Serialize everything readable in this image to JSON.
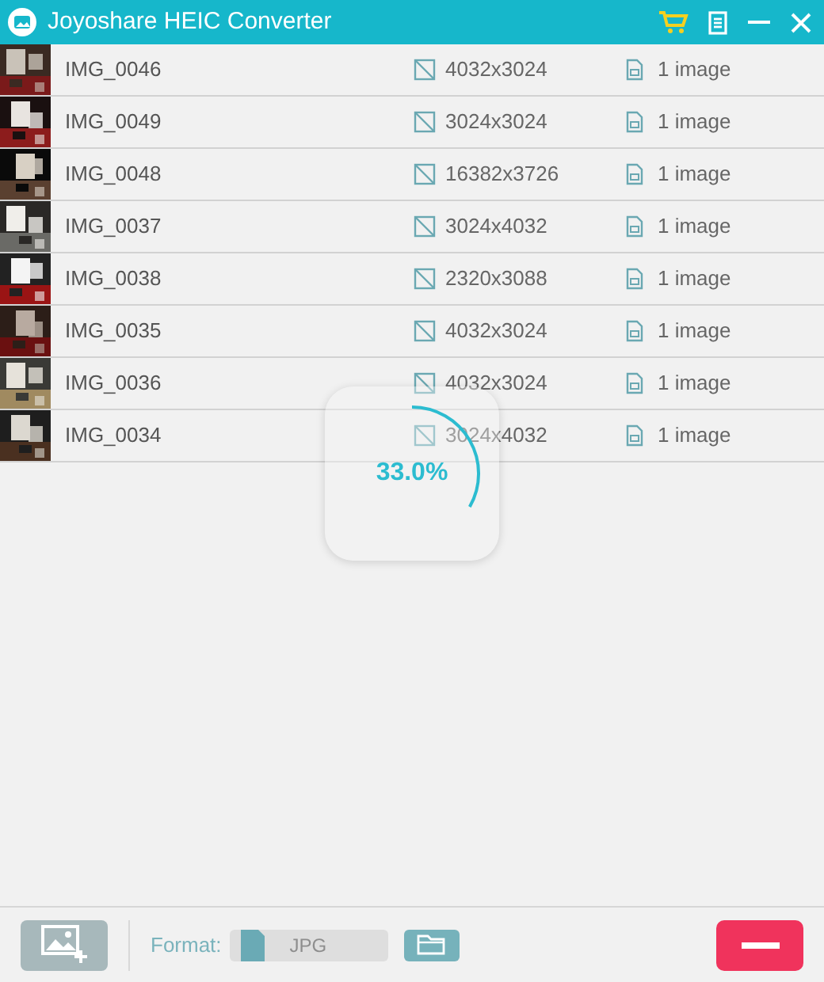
{
  "window": {
    "title": "Joyoshare HEIC Converter"
  },
  "files": [
    {
      "name": "IMG_0046",
      "resolution": "4032x3024",
      "count": "1 image"
    },
    {
      "name": "IMG_0049",
      "resolution": "3024x3024",
      "count": "1 image"
    },
    {
      "name": "IMG_0048",
      "resolution": "16382x3726",
      "count": "1 image"
    },
    {
      "name": "IMG_0037",
      "resolution": "3024x4032",
      "count": "1 image"
    },
    {
      "name": "IMG_0038",
      "resolution": "2320x3088",
      "count": "1 image"
    },
    {
      "name": "IMG_0035",
      "resolution": "4032x3024",
      "count": "1 image"
    },
    {
      "name": "IMG_0036",
      "resolution": "4032x3024",
      "count": "1 image"
    },
    {
      "name": "IMG_0034",
      "resolution": "3024x4032",
      "count": "1 image"
    }
  ],
  "progress": {
    "reading": "33.0%"
  },
  "footer": {
    "format_label": "Format:",
    "format_value": "JPG",
    "format_disabled": true
  }
}
